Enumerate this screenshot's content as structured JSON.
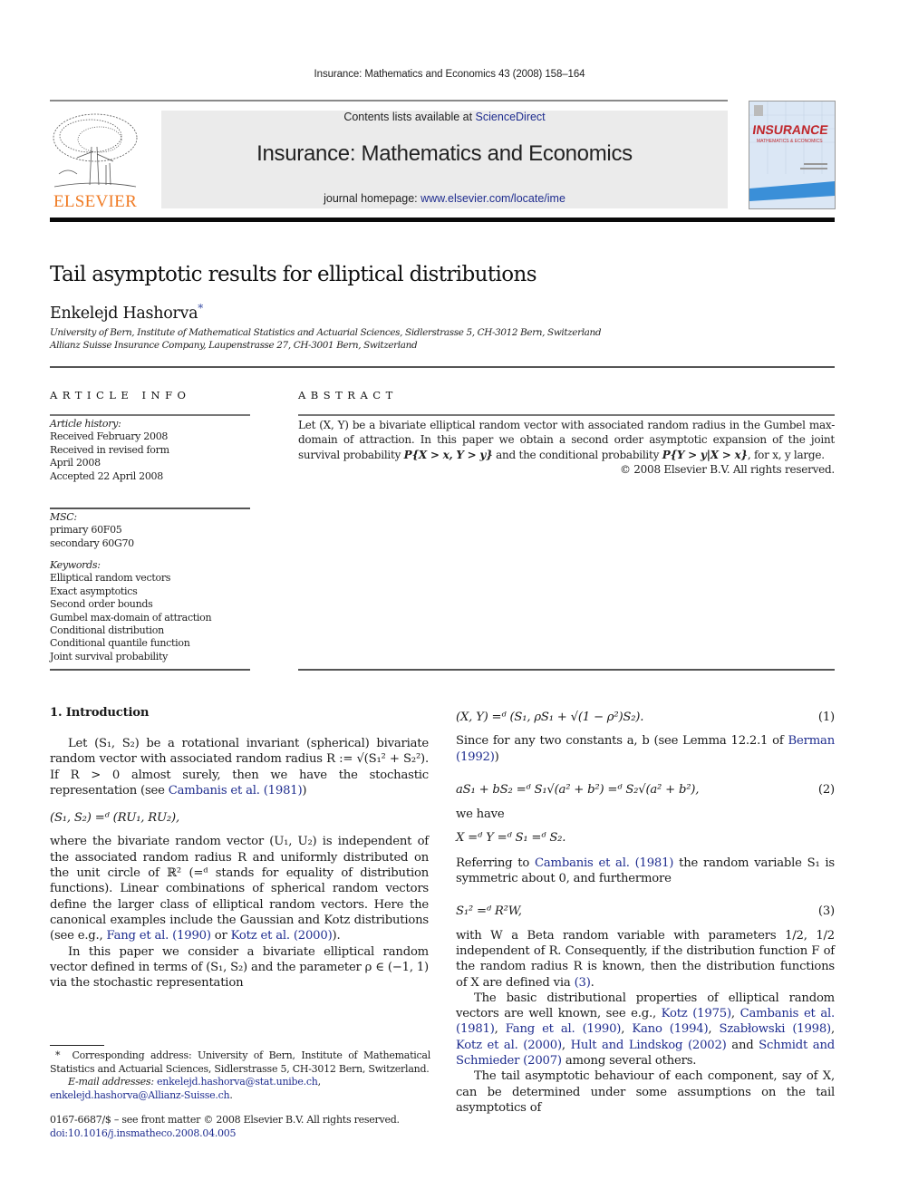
{
  "header": {
    "running_head": "Insurance: Mathematics and Economics 43 (2008) 158–164",
    "contents_prefix": "Contents lists available at ",
    "contents_link": "ScienceDirect",
    "journal_title": "Insurance: Mathematics and Economics",
    "homepage_prefix": "journal homepage: ",
    "homepage_link": "www.elsevier.com/locate/ime",
    "publisher_logo_text": "ELSEVIER",
    "cover_title": "INSURANCE",
    "cover_subtitle": "MATHEMATICS & ECONOMICS",
    "colors": {
      "publisher_orange": "#f07b24",
      "link_blue": "#1f2d8f",
      "banner_gray": "#ebebeb",
      "cover_red": "#c0282d",
      "cover_blue": "#3a8fd8"
    }
  },
  "article": {
    "title": "Tail asymptotic results for elliptical distributions",
    "author": "Enkelejd Hashorva",
    "author_mark": "*",
    "affiliations": [
      "University of Bern, Institute of Mathematical Statistics and Actuarial Sciences, Sidlerstrasse 5, CH-3012 Bern, Switzerland",
      "Allianz Suisse Insurance Company, Laupenstrasse 27, CH-3001 Bern, Switzerland"
    ]
  },
  "article_info": {
    "heading": "ARTICLE INFO",
    "history_label": "Article history:",
    "history": [
      "Received February 2008",
      "Received in revised form",
      "April 2008",
      "Accepted 22 April 2008"
    ],
    "msc_label": "MSC:",
    "msc": [
      "primary 60F05",
      "secondary 60G70"
    ],
    "keywords_label": "Keywords:",
    "keywords": [
      "Elliptical random vectors",
      "Exact asymptotics",
      "Second order bounds",
      "Gumbel max-domain of attraction",
      "Conditional distribution",
      "Conditional quantile function",
      "Joint survival probability"
    ]
  },
  "abstract": {
    "heading": "ABSTRACT",
    "text_1": "Let (X, Y) be a bivariate elliptical random vector with associated random radius in the Gumbel max-domain of attraction. In this paper we obtain a second order asymptotic expansion of the joint survival probability ",
    "prob_1": "P{X > x, Y > y}",
    "text_2": " and the conditional probability ",
    "prob_2": "P{Y > y|X > x}",
    "text_3": ", for x, y large.",
    "copyright": "© 2008 Elsevier B.V. All rights reserved."
  },
  "body": {
    "section_heading": "1.  Introduction",
    "left": {
      "p1_a": "Let (S₁, S₂) be a rotational invariant (spherical) bivariate random vector with associated random radius R := √(S₁² + S₂²). If R > 0 almost surely, then we have the stochastic representation (see ",
      "p1_link": "Cambanis et al. (1981)",
      "p1_b": ")",
      "eq_rep": "(S₁, S₂) =ᵈ (RU₁, RU₂),",
      "p2_a": "where the bivariate random vector (U₁, U₂) is independent of the associated random radius R and uniformly distributed on the unit circle of ℝ² (=ᵈ stands for equality of distribution functions). Linear combinations of spherical random vectors define the larger class of elliptical random vectors. Here the canonical examples include the Gaussian and Kotz distributions (see e.g., ",
      "p2_link1": "Fang et al. (1990)",
      "p2_mid": " or ",
      "p2_link2": "Kotz et al. (2000)",
      "p2_b": ").",
      "p3": "In this paper we consider a bivariate elliptical random vector defined in terms of (S₁, S₂) and the parameter ρ ∈ (−1, 1) via the stochastic representation"
    },
    "right": {
      "eq1": "(X, Y) =ᵈ (S₁, ρS₁ + √(1 − ρ²)S₂).",
      "eq1_num": "(1)",
      "p4_a": "Since for any two constants a, b (see Lemma 12.2.1 of ",
      "p4_link": "Berman (1992)",
      "p4_b": ")",
      "eq2": "aS₁ + bS₂ =ᵈ S₁√(a² + b²) =ᵈ S₂√(a² + b²),",
      "eq2_num": "(2)",
      "p5": "we have",
      "eq_x": "X =ᵈ Y =ᵈ S₁ =ᵈ S₂.",
      "p6_a": "Referring to ",
      "p6_link": "Cambanis et al. (1981)",
      "p6_b": " the random variable S₁ is symmetric about 0, and furthermore",
      "eq3": "S₁² =ᵈ R²W,",
      "eq3_num": "(3)",
      "p7_a": "with W a Beta random variable with parameters 1/2, 1/2 independent of R. Consequently, if the distribution function F of the random radius R is known, then the distribution functions of X are defined via ",
      "p7_link": "(3)",
      "p7_b": ".",
      "p8_a": "The basic distributional properties of elliptical random vectors are well known, see e.g., ",
      "p8_refs": [
        "Kotz (1975)",
        "Cambanis et al. (1981)",
        "Fang et al. (1990)",
        "Kano (1994)",
        "Szabłowski (1998)",
        "Kotz et al. (2000)",
        "Hult and Lindskog (2002)",
        "Schmidt and Schmieder (2007)"
      ],
      "p8_b": " among several others.",
      "p9": "The tail asymptotic behaviour of each component, say of X, can be determined under some assumptions on the tail asymptotics of"
    }
  },
  "footnotes": {
    "mark": "*",
    "corresponding": "Corresponding address: University of Bern, Institute of Mathematical Statistics and Actuarial Sciences, Sidlerstrasse 5, CH-3012 Bern, Switzerland.",
    "email_label": "E-mail addresses:",
    "email_1": "enkelejd.hashorva@stat.unibe.ch",
    "email_2": "enkelejd.hashorva@Allianz-Suisse.ch",
    "issn_line": "0167-6687/$ – see front matter © 2008 Elsevier B.V. All rights reserved.",
    "doi": "doi:10.1016/j.insmatheco.2008.04.005"
  }
}
